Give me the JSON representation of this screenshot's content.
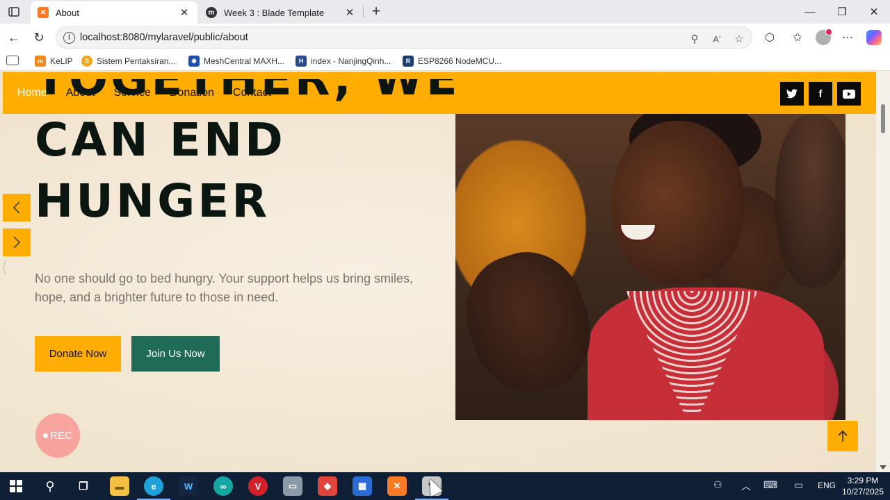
{
  "browser": {
    "tabs": [
      {
        "title": "About",
        "favicon": "xampp-icon",
        "favicon_color": "#fb7a24",
        "active": true
      },
      {
        "title": "Week 3 : Blade Template",
        "favicon": "moodle-icon",
        "favicon_color": "#333333",
        "active": false
      }
    ],
    "url": "localhost:8080/mylaravel/public/about",
    "bookmarks": [
      {
        "label": "KeLIP",
        "icon": "kelip-icon",
        "color": "#f08a1e"
      },
      {
        "label": "Sistem Pentaksiran...",
        "icon": "spm-icon",
        "color": "#f2a61c"
      },
      {
        "label": "MeshCentral MAXH...",
        "icon": "meshcentral-icon",
        "color": "#1e4fa8"
      },
      {
        "label": "index - NanjingQinh...",
        "icon": "nanjing-icon",
        "color": "#2a4c8f"
      },
      {
        "label": "ESP8266 NodeMCU...",
        "icon": "random-nerd-icon",
        "color": "#1d3f72"
      }
    ]
  },
  "site": {
    "nav": [
      {
        "label": "Home",
        "current": true
      },
      {
        "label": "About",
        "current": false
      },
      {
        "label": "Service",
        "current": false
      },
      {
        "label": "Donation",
        "current": false
      },
      {
        "label": "Contact",
        "current": false
      }
    ],
    "social": [
      {
        "name": "twitter-icon",
        "glyph": "🐦"
      },
      {
        "name": "facebook-icon",
        "glyph": "f"
      },
      {
        "name": "youtube-icon",
        "glyph": "▶"
      }
    ],
    "hero": {
      "heading_line1": "TOGETHER, WE",
      "heading_line2": "CAN END",
      "heading_line3": "HUNGER",
      "text": "No one should go to bed hungry. Your support helps us bring smiles, hope, and a brighter future to those in need.",
      "donate_label": "Donate Now",
      "join_label": "Join Us Now"
    },
    "carousel_prev": "‹",
    "carousel_next": "›",
    "rec_label": "REC",
    "back_to_top": "↑",
    "colors": {
      "accent": "#ffad00",
      "secondary": "#1f6b57",
      "heading": "#0c1611"
    }
  },
  "taskbar": {
    "language": "ENG",
    "time": "3:29 PM",
    "date": "10/27/2025"
  }
}
